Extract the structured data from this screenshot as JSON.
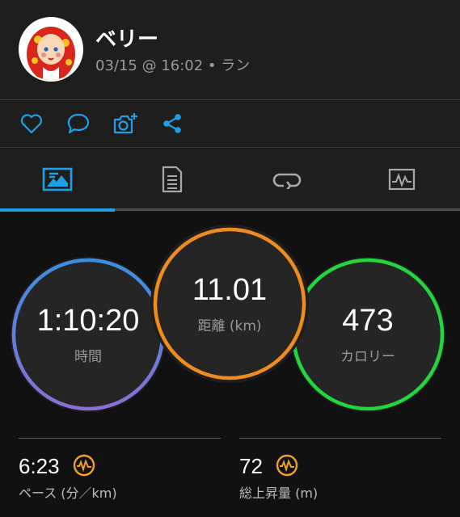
{
  "header": {
    "user_name": "ベリー",
    "activity_meta": "03/15 @ 16:02 • ラン"
  },
  "actions": [
    {
      "name": "like-button",
      "icon": "heart-icon"
    },
    {
      "name": "comment-button",
      "icon": "comment-icon"
    },
    {
      "name": "add-photo-button",
      "icon": "camera-plus-icon"
    },
    {
      "name": "share-button",
      "icon": "share-icon"
    }
  ],
  "tabs": [
    {
      "name": "tab-overview",
      "icon": "overview-icon",
      "active": true
    },
    {
      "name": "tab-details",
      "icon": "document-icon",
      "active": false
    },
    {
      "name": "tab-laps",
      "icon": "laps-icon",
      "active": false
    },
    {
      "name": "tab-charts",
      "icon": "chart-icon",
      "active": false
    }
  ],
  "stats": {
    "time": {
      "value": "1:10:20",
      "label": "時間"
    },
    "distance": {
      "value": "11.01",
      "label": "距離 (km)"
    },
    "calories": {
      "value": "473",
      "label": "カロリー"
    }
  },
  "bottom_stats": {
    "pace": {
      "value": "6:23",
      "label": "ペース (分／km)"
    },
    "elevation": {
      "value": "72",
      "label": "総上昇量 (m)"
    }
  },
  "colors": {
    "accent_blue": "#1ea0e6",
    "time_ring_top": "#3b8fe0",
    "time_ring_bottom": "#8a6fd6",
    "distance_ring": "#f08c1e",
    "calories_ring": "#22d63c",
    "performance_icon": "#f0a21e"
  }
}
